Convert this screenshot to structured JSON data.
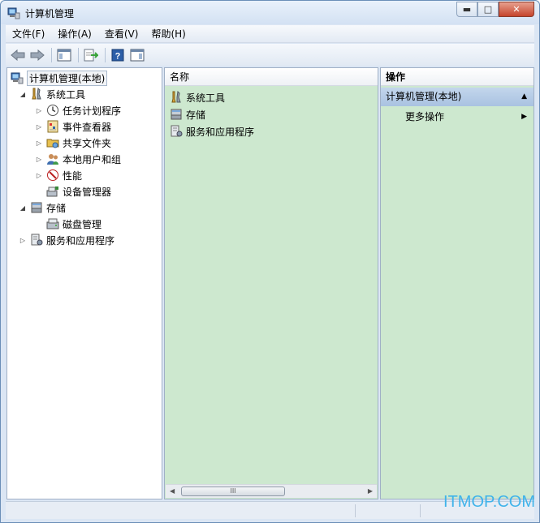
{
  "window": {
    "title": "计算机管理",
    "icons": {
      "app": "computer-management-icon",
      "minimize": "minimize-icon",
      "maximize": "maximize-icon",
      "close": "close-icon"
    }
  },
  "menubar": {
    "items": [
      {
        "label": "文件(F)",
        "name": "menu-file"
      },
      {
        "label": "操作(A)",
        "name": "menu-action"
      },
      {
        "label": "查看(V)",
        "name": "menu-view"
      },
      {
        "label": "帮助(H)",
        "name": "menu-help"
      }
    ]
  },
  "toolbar": {
    "buttons": [
      "back-arrow-icon",
      "forward-arrow-icon",
      "show-hide-tree-icon",
      "export-list-icon",
      "help-icon",
      "show-hide-action-pane-icon"
    ]
  },
  "tree": {
    "items": [
      {
        "label": "计算机管理(本地)",
        "icon": "computer-management-icon",
        "level": 0,
        "expander": "",
        "selected": true
      },
      {
        "label": "系统工具",
        "icon": "system-tools-icon",
        "level": 1,
        "expander": "expanded"
      },
      {
        "label": "任务计划程序",
        "icon": "task-scheduler-icon",
        "level": 2,
        "expander": "collapsed"
      },
      {
        "label": "事件查看器",
        "icon": "event-viewer-icon",
        "level": 2,
        "expander": "collapsed"
      },
      {
        "label": "共享文件夹",
        "icon": "shared-folders-icon",
        "level": 2,
        "expander": "collapsed"
      },
      {
        "label": "本地用户和组",
        "icon": "local-users-groups-icon",
        "level": 2,
        "expander": "collapsed"
      },
      {
        "label": "性能",
        "icon": "performance-icon",
        "level": 2,
        "expander": "collapsed"
      },
      {
        "label": "设备管理器",
        "icon": "device-manager-icon",
        "level": 2,
        "expander": ""
      },
      {
        "label": "存储",
        "icon": "storage-icon",
        "level": 1,
        "expander": "expanded"
      },
      {
        "label": "磁盘管理",
        "icon": "disk-management-icon",
        "level": 2,
        "expander": ""
      },
      {
        "label": "服务和应用程序",
        "icon": "services-applications-icon",
        "level": 1,
        "expander": "collapsed"
      }
    ]
  },
  "list": {
    "header": "名称",
    "items": [
      {
        "label": "系统工具",
        "icon": "system-tools-icon"
      },
      {
        "label": "存储",
        "icon": "storage-icon"
      },
      {
        "label": "服务和应用程序",
        "icon": "services-applications-icon"
      }
    ],
    "scroll_thumb": "III"
  },
  "actions": {
    "header": "操作",
    "section": "计算机管理(本地)",
    "items": [
      {
        "label": "更多操作"
      }
    ]
  },
  "watermark": "ITMOP.COM",
  "colors": {
    "pane_bg": "#cde8cf",
    "section_bg": "#b2c8e4",
    "watermark": "#3fb3ea"
  }
}
